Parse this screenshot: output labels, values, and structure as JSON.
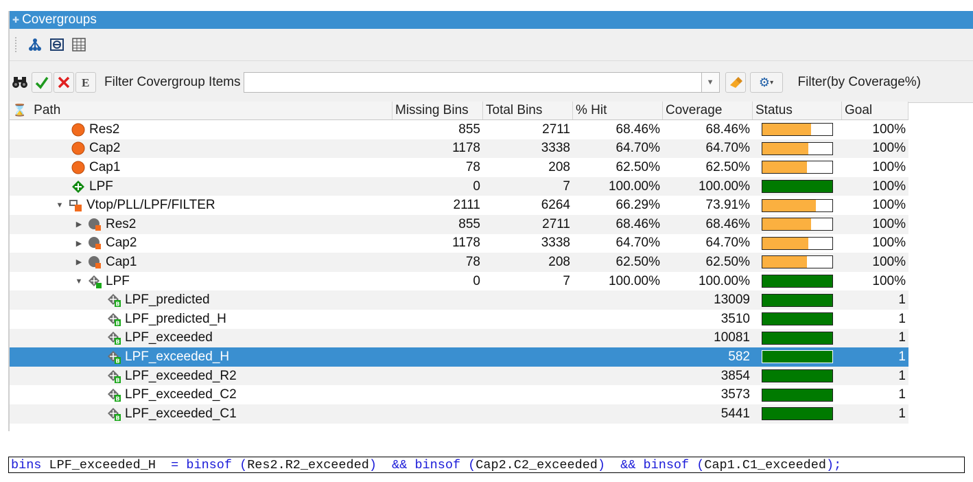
{
  "title": "Covergroups",
  "toolbar1": {
    "icons": [
      "hierarchy-icon",
      "collapse-icon",
      "columns-icon"
    ]
  },
  "filter": {
    "label": "Filter Covergroup Items",
    "value": "",
    "coverage_label": "Filter(by Coverage%)"
  },
  "columns": [
    "Path",
    "Missing Bins",
    "Total Bins",
    "% Hit",
    "Coverage",
    "Status",
    "Goal"
  ],
  "colors": {
    "orange": "#fbb040",
    "green": "#007a00",
    "selection": "#3a8fd0",
    "titlebar": "#3a8fd0"
  },
  "rows": [
    {
      "name": "Res2",
      "indent": 90,
      "arrow": "",
      "icon": "orange-circle",
      "missing": "855",
      "total": "2711",
      "hit": "68.46%",
      "coverage": "68.46%",
      "fill": 0.7,
      "color": "orange",
      "goal": "100%"
    },
    {
      "name": "Cap2",
      "indent": 90,
      "arrow": "",
      "icon": "orange-circle",
      "missing": "1178",
      "total": "3338",
      "hit": "64.70%",
      "coverage": "64.70%",
      "fill": 0.66,
      "color": "orange",
      "goal": "100%"
    },
    {
      "name": "Cap1",
      "indent": 90,
      "arrow": "",
      "icon": "orange-circle",
      "missing": "78",
      "total": "208",
      "hit": "62.50%",
      "coverage": "62.50%",
      "fill": 0.64,
      "color": "orange",
      "goal": "100%"
    },
    {
      "name": "LPF",
      "indent": 90,
      "arrow": "",
      "icon": "green-diamond",
      "missing": "0",
      "total": "7",
      "hit": "100.00%",
      "coverage": "100.00%",
      "fill": 1.0,
      "color": "green",
      "goal": "100%"
    },
    {
      "name": "Vtop/PLL/LPF/FILTER",
      "indent": 66,
      "arrow": "down",
      "icon": "instance",
      "missing": "2111",
      "total": "6264",
      "hit": "66.29%",
      "coverage": "73.91%",
      "fill": 0.76,
      "color": "orange",
      "goal": "100%"
    },
    {
      "name": "Res2",
      "indent": 94,
      "arrow": "right",
      "icon": "gray-circle",
      "missing": "855",
      "total": "2711",
      "hit": "68.46%",
      "coverage": "68.46%",
      "fill": 0.7,
      "color": "orange",
      "goal": "100%"
    },
    {
      "name": "Cap2",
      "indent": 94,
      "arrow": "right",
      "icon": "gray-circle",
      "missing": "1178",
      "total": "3338",
      "hit": "64.70%",
      "coverage": "64.70%",
      "fill": 0.66,
      "color": "orange",
      "goal": "100%"
    },
    {
      "name": "Cap1",
      "indent": 94,
      "arrow": "right",
      "icon": "gray-circle",
      "missing": "78",
      "total": "208",
      "hit": "62.50%",
      "coverage": "62.50%",
      "fill": 0.64,
      "color": "orange",
      "goal": "100%"
    },
    {
      "name": "LPF",
      "indent": 94,
      "arrow": "down",
      "icon": "gray-diamond",
      "missing": "0",
      "total": "7",
      "hit": "100.00%",
      "coverage": "100.00%",
      "fill": 1.0,
      "color": "green",
      "goal": "100%"
    },
    {
      "name": "LPF_predicted",
      "indent": 142,
      "arrow": "",
      "icon": "bin-diamond",
      "missing": "",
      "total": "",
      "hit": "",
      "coverage": "13009",
      "fill": 1.0,
      "color": "green",
      "goal": "1"
    },
    {
      "name": "LPF_predicted_H",
      "indent": 142,
      "arrow": "",
      "icon": "bin-diamond",
      "missing": "",
      "total": "",
      "hit": "",
      "coverage": "3510",
      "fill": 1.0,
      "color": "green",
      "goal": "1"
    },
    {
      "name": "LPF_exceeded",
      "indent": 142,
      "arrow": "",
      "icon": "bin-diamond",
      "missing": "",
      "total": "",
      "hit": "",
      "coverage": "10081",
      "fill": 1.0,
      "color": "green",
      "goal": "1"
    },
    {
      "name": "LPF_exceeded_H",
      "indent": 142,
      "arrow": "",
      "icon": "bin-diamond",
      "missing": "",
      "total": "",
      "hit": "",
      "coverage": "582",
      "fill": 1.0,
      "color": "green",
      "goal": "1",
      "selected": true
    },
    {
      "name": "LPF_exceeded_R2",
      "indent": 142,
      "arrow": "",
      "icon": "bin-diamond",
      "missing": "",
      "total": "",
      "hit": "",
      "coverage": "3854",
      "fill": 1.0,
      "color": "green",
      "goal": "1"
    },
    {
      "name": "LPF_exceeded_C2",
      "indent": 142,
      "arrow": "",
      "icon": "bin-diamond",
      "missing": "",
      "total": "",
      "hit": "",
      "coverage": "3573",
      "fill": 1.0,
      "color": "green",
      "goal": "1"
    },
    {
      "name": "LPF_exceeded_C1",
      "indent": 142,
      "arrow": "",
      "icon": "bin-diamond",
      "missing": "",
      "total": "",
      "hit": "",
      "coverage": "5441",
      "fill": 1.0,
      "color": "green",
      "goal": "1"
    }
  ],
  "code": {
    "parts": [
      {
        "t": "bins",
        "k": true
      },
      {
        "t": " LPF_exceeded_H  ",
        "k": false
      },
      {
        "t": "= binsof (",
        "k": true
      },
      {
        "t": "Res2.R2_exceeded",
        "k": false
      },
      {
        "t": ")  && binsof (",
        "k": true
      },
      {
        "t": "Cap2.C2_exceeded",
        "k": false
      },
      {
        "t": ")  && binsof (",
        "k": true
      },
      {
        "t": "Cap1.C1_exceeded",
        "k": false
      },
      {
        "t": ");",
        "k": true
      }
    ]
  }
}
